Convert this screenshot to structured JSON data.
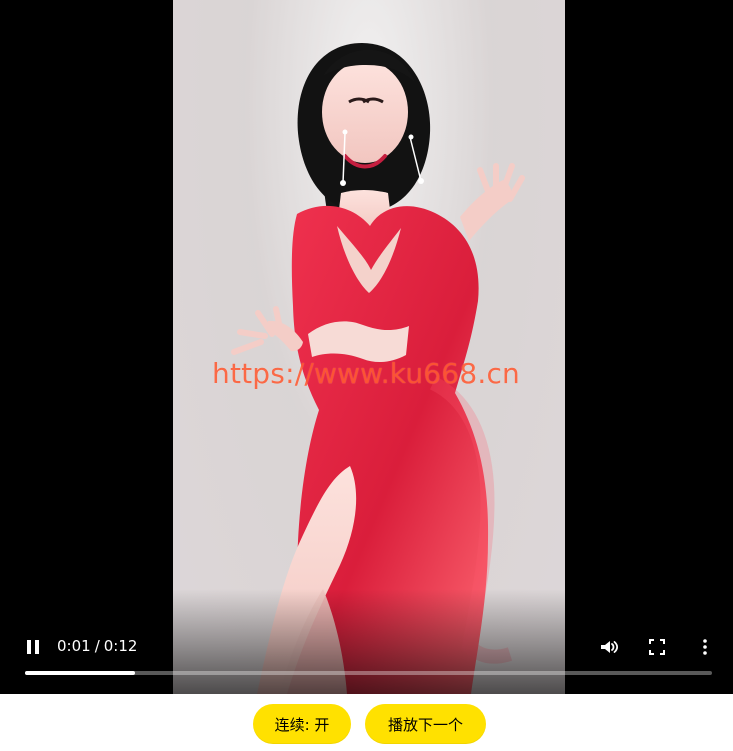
{
  "player": {
    "watermark": "https://www.ku668.cn",
    "time": {
      "current": "0:01",
      "separator": "/",
      "duration": "0:12"
    },
    "progress_fraction": 0.16,
    "icons": {
      "play_pause": "pause-icon",
      "volume": "volume-icon",
      "fullscreen": "fullscreen-icon",
      "more": "more-vertical-icon"
    }
  },
  "buttons": {
    "continuous_label": "连续: 开",
    "next_label": "播放下一个"
  },
  "colors": {
    "button_bg": "#ffe100",
    "watermark": "#ff4e23",
    "player_bg": "#000000",
    "progress_fill": "#ffffff"
  }
}
